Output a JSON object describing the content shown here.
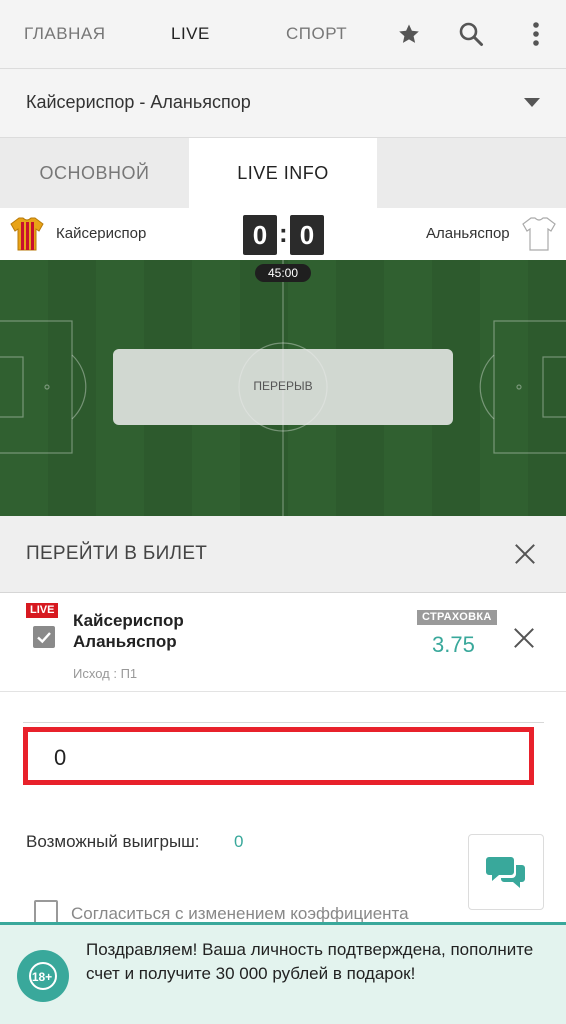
{
  "topnav": {
    "tabs": [
      {
        "label": "ГЛАВНАЯ"
      },
      {
        "label": "LIVE"
      },
      {
        "label": "СПОРТ"
      }
    ],
    "icons": [
      "star-icon",
      "search-icon",
      "more-vert-icon"
    ]
  },
  "match_selector": {
    "label": "Кайсериспор - Аланьяспор"
  },
  "subtabs": [
    {
      "label": "ОСНОВНОЙ"
    },
    {
      "label": "LIVE INFO"
    }
  ],
  "scoreboard": {
    "home_team": "Кайсериспор",
    "away_team": "Аланьяспор",
    "home_score": "0",
    "away_score": "0",
    "separator": ":",
    "home_kit_color": "#e8a317",
    "home_kit_stripe": "#c8102e",
    "away_kit_color": "#ffffff"
  },
  "field": {
    "timer": "45:00",
    "status": "ПЕРЕРЫВ",
    "grass_dark": "#2d5a2d",
    "grass_light": "#336633"
  },
  "ticket": {
    "header_title": "ПЕРЕЙТИ В БИЛЕТ",
    "bet": {
      "live_badge": "LIVE",
      "team1": "Кайсериспор",
      "team2": "Аланьяспор",
      "outcome": "Исход : П1",
      "insurance_badge": "СТРАХОВКА",
      "odds": "3.75"
    },
    "stake_value": "0",
    "winnings_label": "Возможный выигрыш:",
    "winnings_value": "0",
    "agree_label": "Согласиться с изменением коэффициента"
  },
  "banner": {
    "badge": "18+",
    "message": "Поздравляем! Ваша личность подтверждена, пополните счет и получите 30 000 рублей в подарок!"
  },
  "colors": {
    "accent": "#39a89b",
    "live_red": "#d71920",
    "input_border": "#e8212b"
  }
}
